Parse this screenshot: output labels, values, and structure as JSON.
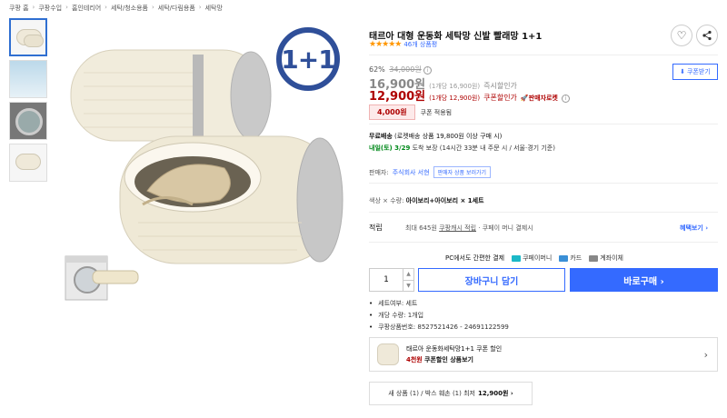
{
  "breadcrumb": [
    "쿠팡 홈",
    "쿠팡수입",
    "홈인테리어",
    "세탁/청소용품",
    "세탁/다림용품",
    "세탁망"
  ],
  "badge": "1+1",
  "product": {
    "title": "태르아 대형 운동화 세탁망 신발 빨래망 1+1",
    "stars": "★★★★★",
    "review_count": "46개 상품평"
  },
  "price": {
    "discount_rate": "62%",
    "original_price": "34,000원",
    "sale_price": "16,900원",
    "sale_unit": "(1개당 16,900원)",
    "sale_label": "즉시할인가",
    "coupon_price": "12,900원",
    "coupon_unit": "(1개당 12,900원)",
    "coupon_label": "쿠폰할인가",
    "seller_rocket": "판매자로켓",
    "coupon_amount": "4,000원",
    "coupon_applied": "쿠폰 적용됨",
    "coupon_button": "쿠폰받기"
  },
  "shipping": {
    "free_label": "무료배송",
    "free_detail": "(로켓배송 상품 19,800원 이상 구매 시)",
    "arrival_day": "내일(토) 3/29",
    "arrival_detail": "도착 보장 (14시간 33분  내 주문 시 / 서울⋅경기 기준)"
  },
  "seller": {
    "label": "판매자:",
    "name": "주식회사 서현",
    "button": "판매자 상품 보러가기"
  },
  "option": {
    "label": "색상 × 수량:",
    "value": "아이보리+아이보리 × 1세트"
  },
  "reward": {
    "label": "적립",
    "prefix": "최대 645원",
    "cash": "쿠팡캐시 적립",
    "suffix": "· 쿠페이 머니 결제시",
    "benefit_link": "혜택보기 ›"
  },
  "payment": {
    "lead": "PC에서도 간편한 결제",
    "options": [
      "쿠페이머니",
      "카드",
      "계좌이체"
    ]
  },
  "purchase": {
    "quantity": "1",
    "cart_button": "장바구니 담기",
    "buy_button": "바로구매 ›"
  },
  "details": [
    "세트여부: 세트",
    "개당 수량: 1개입",
    "쿠팡상품번호: 8527521426 - 24691122599"
  ],
  "promo": {
    "title": "태르아 운동화세탁망1+1 쿠폰 할인",
    "red": "4천원",
    "rest": "쿠폰할인 상품보기"
  },
  "used": {
    "text": "새 상품 (1) / 박스 훼손 (1) 최저",
    "price": "12,900원 ›"
  },
  "colors": {
    "accent": "#346aff",
    "price_red": "#ae0000",
    "arrival_green": "#00891a",
    "star": "#ff9600",
    "badge_blue": "#2f4f99"
  }
}
